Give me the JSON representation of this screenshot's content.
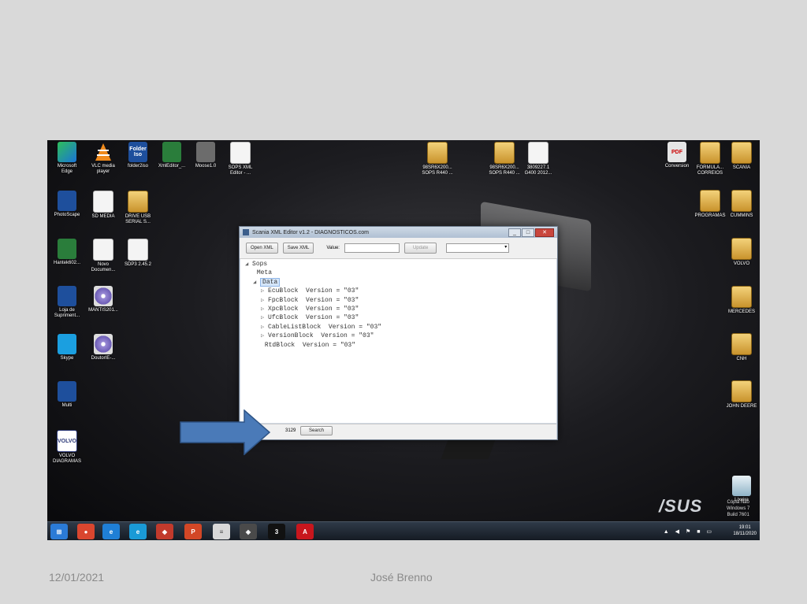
{
  "desktop": {
    "icons": [
      {
        "label": "Microsoft\nEdge",
        "icon": "edge-icon"
      },
      {
        "label": "VLC media\nplayer",
        "icon": "vlc-icon"
      },
      {
        "label": "folder2iso",
        "icon": "folder2iso-icon",
        "glyph": "Folder\nIso"
      },
      {
        "label": "XmlEditor_...",
        "icon": "xml-editor-icon"
      },
      {
        "label": "Moose1.0",
        "icon": "moose-icon"
      },
      {
        "label": "SOPS XML\nEditor - ...",
        "icon": "sops-xml-editor-icon"
      },
      {
        "label": "PhotoScape",
        "icon": "photoscape-icon"
      },
      {
        "label": "SD MEDIA",
        "icon": "file-icon"
      },
      {
        "label": "DRIVE USB\nSERIAL S...",
        "icon": "drive-usb-icon"
      },
      {
        "label": "Hantek602...",
        "icon": "hantek-icon"
      },
      {
        "label": "Novo\nDocumen...",
        "icon": "file-icon"
      },
      {
        "label": "SDP3 2.45.2",
        "icon": "file-icon"
      },
      {
        "label": "Loja de\nSupriment...",
        "icon": "printer-icon"
      },
      {
        "label": "MANTIS201...",
        "icon": "cd-icon"
      },
      {
        "label": "Skype",
        "icon": "skype-icon"
      },
      {
        "label": "DoutorIE-...",
        "icon": "cd-icon"
      },
      {
        "label": "Multi",
        "icon": "multi-icon"
      },
      {
        "label": "VOLVO\nDIAGRAMAS",
        "icon": "volvo-icon",
        "glyph": "VOLVO"
      },
      {
        "label": "98SR6X200...\nSOPS R440 ...",
        "icon": "folder-icon"
      },
      {
        "label": "98SR6X200...\nSOPS R440 ...",
        "icon": "folder-icon"
      },
      {
        "label": "3809227.1\nG400 2012...",
        "icon": "file-icon"
      },
      {
        "label": "Conversion",
        "icon": "pdf-icon",
        "glyph": "PDF"
      },
      {
        "label": "FORMULA...\nCORREIOS",
        "icon": "folder-icon"
      },
      {
        "label": "SCANIA",
        "icon": "folder-icon"
      },
      {
        "label": "PROGRAMAS",
        "icon": "folder-icon"
      },
      {
        "label": "CUMMINS",
        "icon": "folder-icon"
      },
      {
        "label": "VOLVO",
        "icon": "folder-icon"
      },
      {
        "label": "MERCEDES",
        "icon": "folder-icon"
      },
      {
        "label": "CNH",
        "icon": "folder-icon"
      },
      {
        "label": "JOHN DEERE",
        "icon": "folder-icon"
      },
      {
        "label": "Lixeira",
        "icon": "recycle-bin-icon"
      }
    ],
    "brand": "/SUS",
    "windows_info": "Cópia Não\nWindows 7\nBuild 7601"
  },
  "app": {
    "title": "Scania XML Editor v1.2 - DIAGNOSTICOS.com",
    "toolbar": {
      "open_label": "Open XML",
      "save_label": "Save XML",
      "value_label": "Value:",
      "value_input": "",
      "update_label": "Update",
      "combo_value": ""
    },
    "tree": [
      {
        "text": "Sops",
        "exp": "◢",
        "level": 0
      },
      {
        "text": "Meta",
        "exp": "",
        "level": 1
      },
      {
        "text": "Data",
        "exp": "◢",
        "level": 1,
        "selected": true
      },
      {
        "text": "EcuBlock  Version = \"03\"",
        "exp": "▷",
        "level": 2
      },
      {
        "text": "FpcBlock  Version = \"03\"",
        "exp": "▷",
        "level": 2
      },
      {
        "text": "XpcBlock  Version = \"03\"",
        "exp": "▷",
        "level": 2
      },
      {
        "text": "UfcBlock  Version = \"03\"",
        "exp": "▷",
        "level": 2
      },
      {
        "text": "CableListBlock  Version = \"03\"",
        "exp": "▷",
        "level": 2
      },
      {
        "text": "VersionBlock  Version = \"03\"",
        "exp": "▷",
        "level": 2
      },
      {
        "text": "RtdBlock  Version = \"03\"",
        "exp": "",
        "level": 2
      }
    ],
    "search_value": "3129",
    "search_label": "Search"
  },
  "taskbar": {
    "items": [
      {
        "icon": "start-orb-icon",
        "color": "#2b7bd6",
        "glyph": "⊞"
      },
      {
        "icon": "chrome-icon",
        "color": "#d9462f",
        "glyph": "●"
      },
      {
        "icon": "ie-icon",
        "color": "#1f7fd6",
        "glyph": "e"
      },
      {
        "icon": "edge-taskbar-icon",
        "color": "#1a9ad6",
        "glyph": "e"
      },
      {
        "icon": "app-red-icon",
        "color": "#c23a2c",
        "glyph": "◆"
      },
      {
        "icon": "powerpoint-icon",
        "color": "#d24726",
        "glyph": "P"
      },
      {
        "icon": "notepad-icon",
        "color": "#d8d8d8",
        "glyph": "≡"
      },
      {
        "icon": "storage-icon",
        "color": "#4a4a4a",
        "glyph": "◈"
      },
      {
        "icon": "sdp3-icon",
        "color": "#111111",
        "glyph": "3"
      },
      {
        "icon": "acrobat-icon",
        "color": "#c8161d",
        "glyph": "A"
      }
    ],
    "clock_time": "19:01",
    "clock_date": "18/11/2020"
  },
  "slide": {
    "date": "12/01/2021",
    "author": "José Brenno"
  },
  "colors": {
    "arrow": "#4a7ab8",
    "selection": "#d5e6fa"
  }
}
